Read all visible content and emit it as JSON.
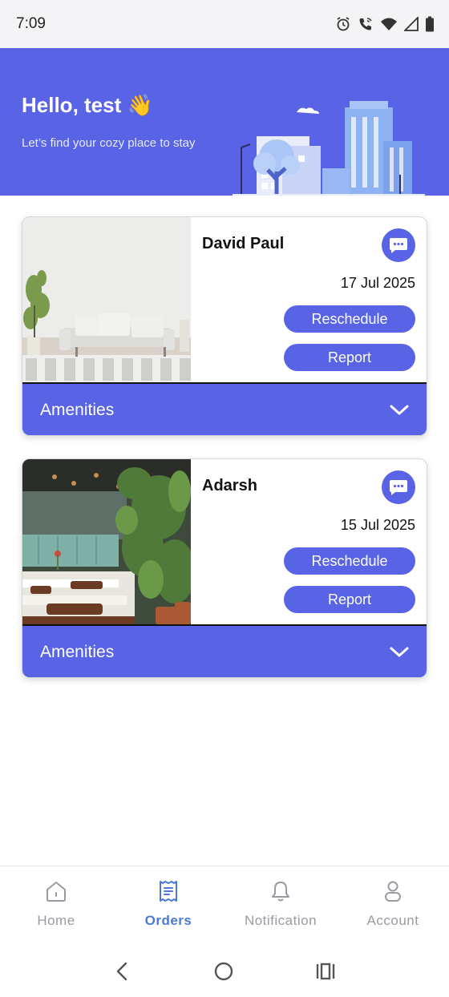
{
  "status_bar": {
    "time": "7:09",
    "icons": [
      "alarm-icon",
      "wifi-calling-icon",
      "wifi-icon",
      "cell-signal-icon",
      "battery-icon"
    ]
  },
  "header": {
    "greeting": "Hello, test 👋",
    "subtitle": "Let’s find your cozy place to stay"
  },
  "bookings": [
    {
      "name": "David Paul",
      "date": "17 Jul 2025",
      "reschedule_label": "Reschedule",
      "report_label": "Report",
      "amenities_label": "Amenities"
    },
    {
      "name": "Adarsh",
      "date": "15 Jul 2025",
      "reschedule_label": "Reschedule",
      "report_label": "Report",
      "amenities_label": "Amenities"
    }
  ],
  "bottom_nav": {
    "items": [
      {
        "label": "Home",
        "icon": "home-icon"
      },
      {
        "label": "Orders",
        "icon": "receipt-icon",
        "active": true
      },
      {
        "label": "Notification",
        "icon": "bell-icon"
      },
      {
        "label": "Account",
        "icon": "person-icon"
      }
    ]
  },
  "colors": {
    "accent": "#5963e6",
    "active_nav": "#4a7ad6",
    "inactive_nav": "#9a9aa2"
  }
}
